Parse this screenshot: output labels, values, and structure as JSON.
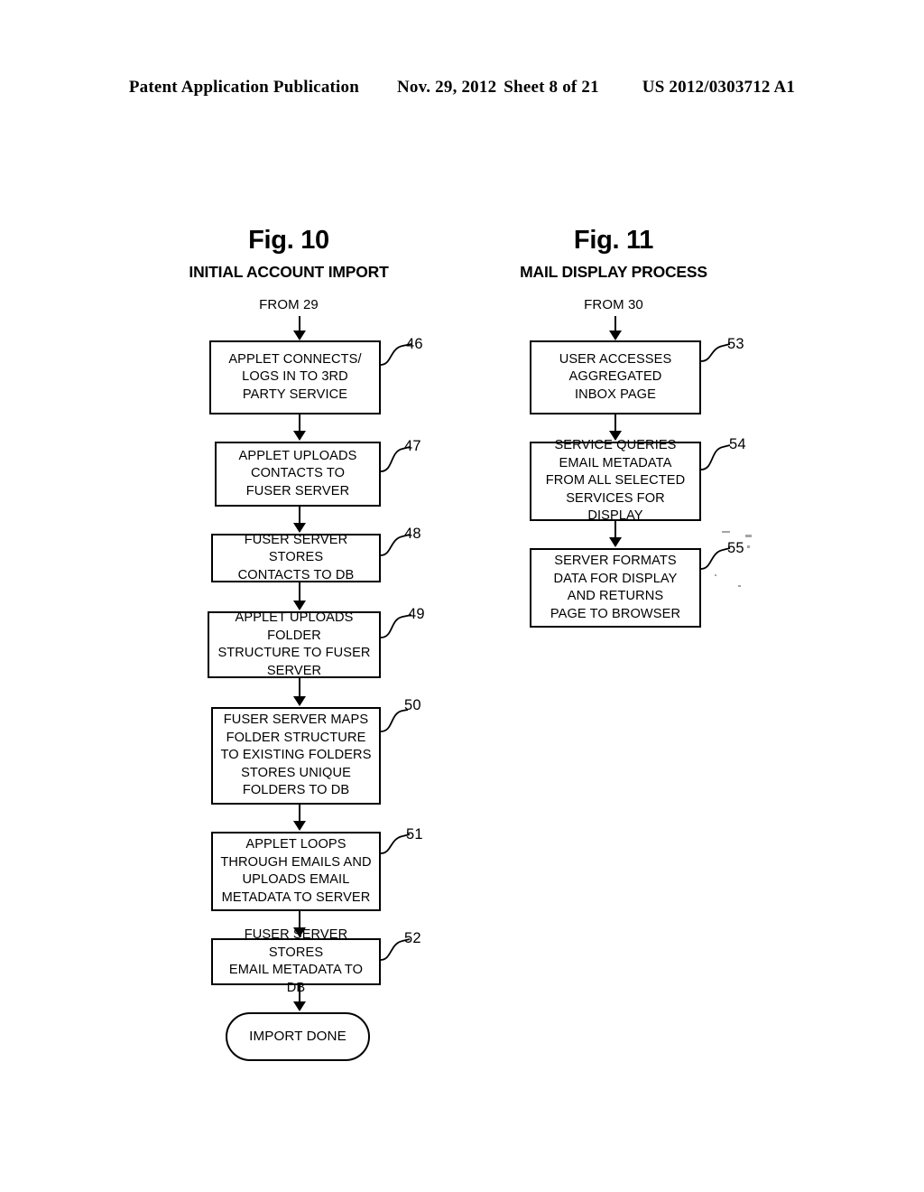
{
  "header": {
    "publication": "Patent Application Publication",
    "date": "Nov. 29, 2012",
    "sheet": "Sheet 8 of 21",
    "document_number": "US 2012/0303712 A1"
  },
  "figures": [
    {
      "id": "fig-10",
      "title": "Fig. 10",
      "subtitle": "INITIAL ACCOUNT IMPORT",
      "entry_label": "FROM 29",
      "nodes": [
        {
          "ref": "46",
          "shape": "process",
          "text": "APPLET CONNECTS/\nLOGS IN TO 3RD\nPARTY SERVICE"
        },
        {
          "ref": "47",
          "shape": "process",
          "text": "APPLET UPLOADS\nCONTACTS TO\nFUSER SERVER"
        },
        {
          "ref": "48",
          "shape": "process",
          "text": "FUSER SERVER STORES\nCONTACTS TO DB"
        },
        {
          "ref": "49",
          "shape": "process",
          "text": "APPLET UPLOADS FOLDER\nSTRUCTURE TO FUSER\nSERVER"
        },
        {
          "ref": "50",
          "shape": "process",
          "text": "FUSER SERVER MAPS\nFOLDER STRUCTURE\nTO EXISTING FOLDERS\nSTORES UNIQUE\nFOLDERS TO DB"
        },
        {
          "ref": "51",
          "shape": "process",
          "text": "APPLET LOOPS\nTHROUGH EMAILS AND\nUPLOADS EMAIL\nMETADATA TO SERVER"
        },
        {
          "ref": "52",
          "shape": "process",
          "text": "FUSER SERVER STORES\nEMAIL METADATA TO DB"
        },
        {
          "ref": "",
          "shape": "terminal",
          "text": "IMPORT DONE"
        }
      ]
    },
    {
      "id": "fig-11",
      "title": "Fig. 11",
      "subtitle": "MAIL DISPLAY PROCESS",
      "entry_label": "FROM 30",
      "nodes": [
        {
          "ref": "53",
          "shape": "process",
          "text": "USER ACCESSES\nAGGREGATED\nINBOX PAGE"
        },
        {
          "ref": "54",
          "shape": "process",
          "text": "SERVICE QUERIES\nEMAIL METADATA\nFROM ALL SELECTED\nSERVICES FOR DISPLAY"
        },
        {
          "ref": "55",
          "shape": "process",
          "text": "SERVER FORMATS\nDATA FOR DISPLAY\nAND RETURNS\nPAGE TO BROWSER"
        }
      ]
    }
  ]
}
